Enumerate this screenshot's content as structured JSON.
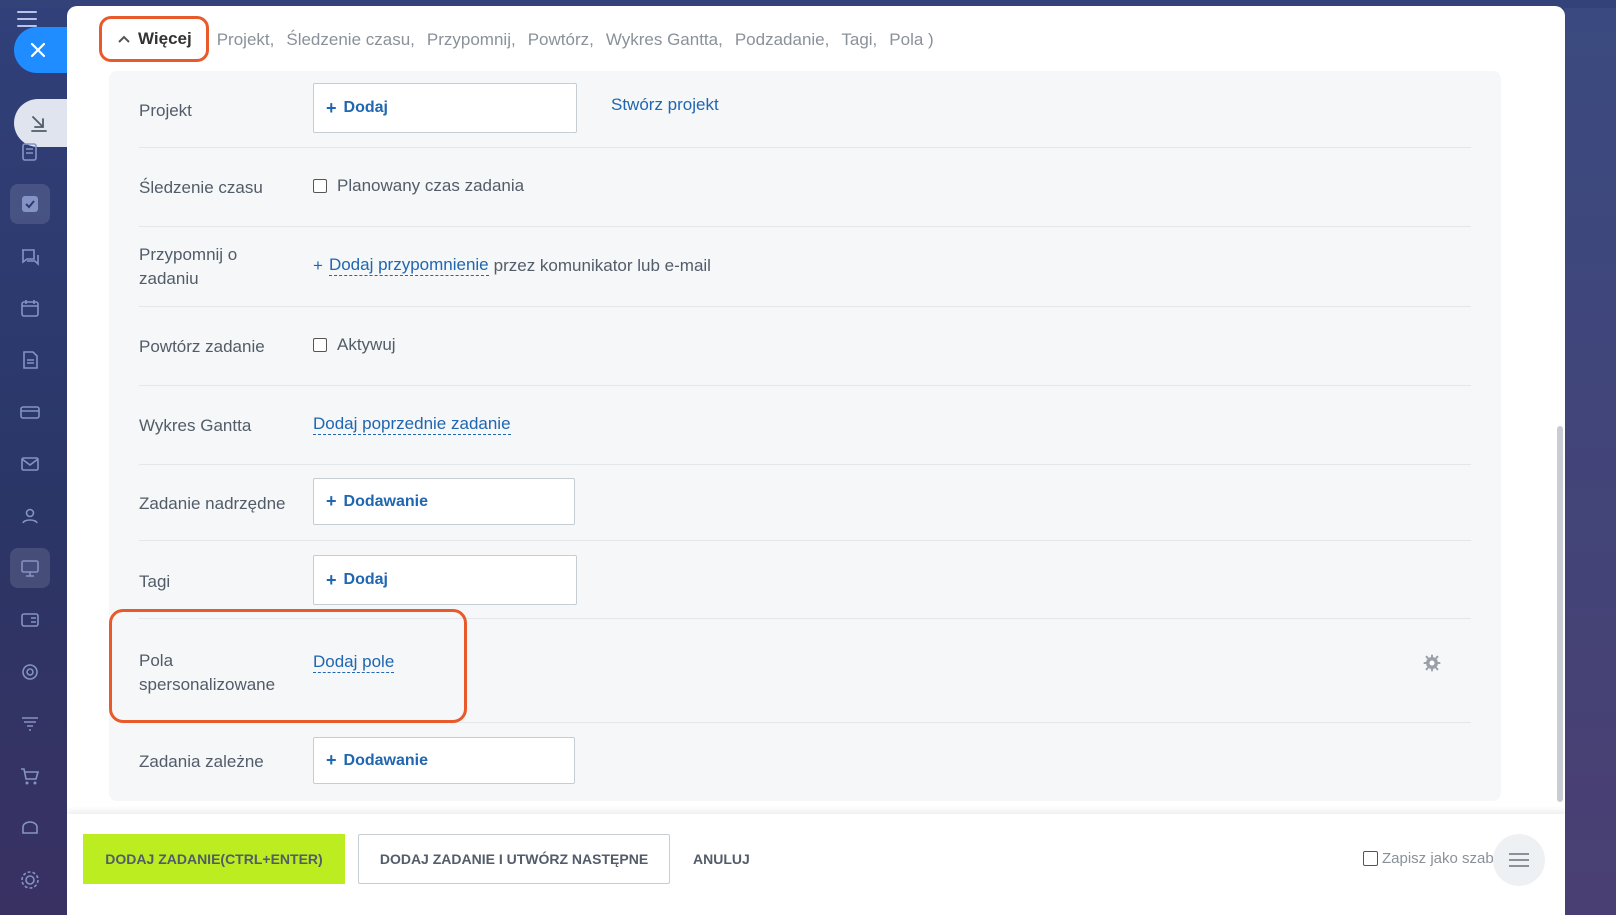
{
  "colors": {
    "accent": "#2066b0",
    "primary_button": "#bbed21",
    "highlight": "#e85a2c",
    "close_button": "#1f8cff"
  },
  "more": {
    "toggle_label": "Więcej",
    "items": [
      "Projekt,",
      "Śledzenie czasu,",
      "Przypomnij,",
      "Powtórz,",
      "Wykres Gantta,",
      "Podzadanie,",
      "Tagi,",
      "Pola )"
    ]
  },
  "rows": {
    "project": {
      "label": "Projekt",
      "add_label": "Dodaj",
      "create_link": "Stwórz projekt"
    },
    "time_tracking": {
      "label": "Śledzenie czasu",
      "checkbox_label": "Planowany czas zadania"
    },
    "reminder": {
      "label": "Przypomnij o zadaniu",
      "plus": "+",
      "link": "Dodaj przypomnienie",
      "suffix": "przez komunikator lub e-mail"
    },
    "repeat": {
      "label": "Powtórz zadanie",
      "checkbox_label": "Aktywuj"
    },
    "gantt": {
      "label": "Wykres Gantta",
      "link": "Dodaj poprzednie zadanie"
    },
    "parent": {
      "label": "Zadanie nadrzędne",
      "add_label": "Dodawanie"
    },
    "tags": {
      "label": "Tagi",
      "add_label": "Dodaj"
    },
    "custom_fields": {
      "label": "Pola spersonalizowane",
      "link": "Dodaj pole"
    },
    "dependent": {
      "label": "Zadania zależne",
      "add_label": "Dodawanie"
    }
  },
  "footer": {
    "add_task": "DODAJ ZADANIE(CTRL+ENTER)",
    "add_and_next": "DODAJ ZADANIE I UTWÓRZ NASTĘPNE",
    "cancel": "ANULUJ",
    "save_template": "Zapisz jako szablon"
  },
  "sidebar": {
    "icons": [
      "list-icon",
      "tasks-icon",
      "chat-icon",
      "calendar-icon",
      "document-icon",
      "card-icon",
      "mail-icon",
      "users-icon",
      "board-icon",
      "contact-card-icon",
      "target-icon",
      "filter-icon",
      "cart-icon",
      "storage-icon",
      "settings-icon"
    ]
  }
}
